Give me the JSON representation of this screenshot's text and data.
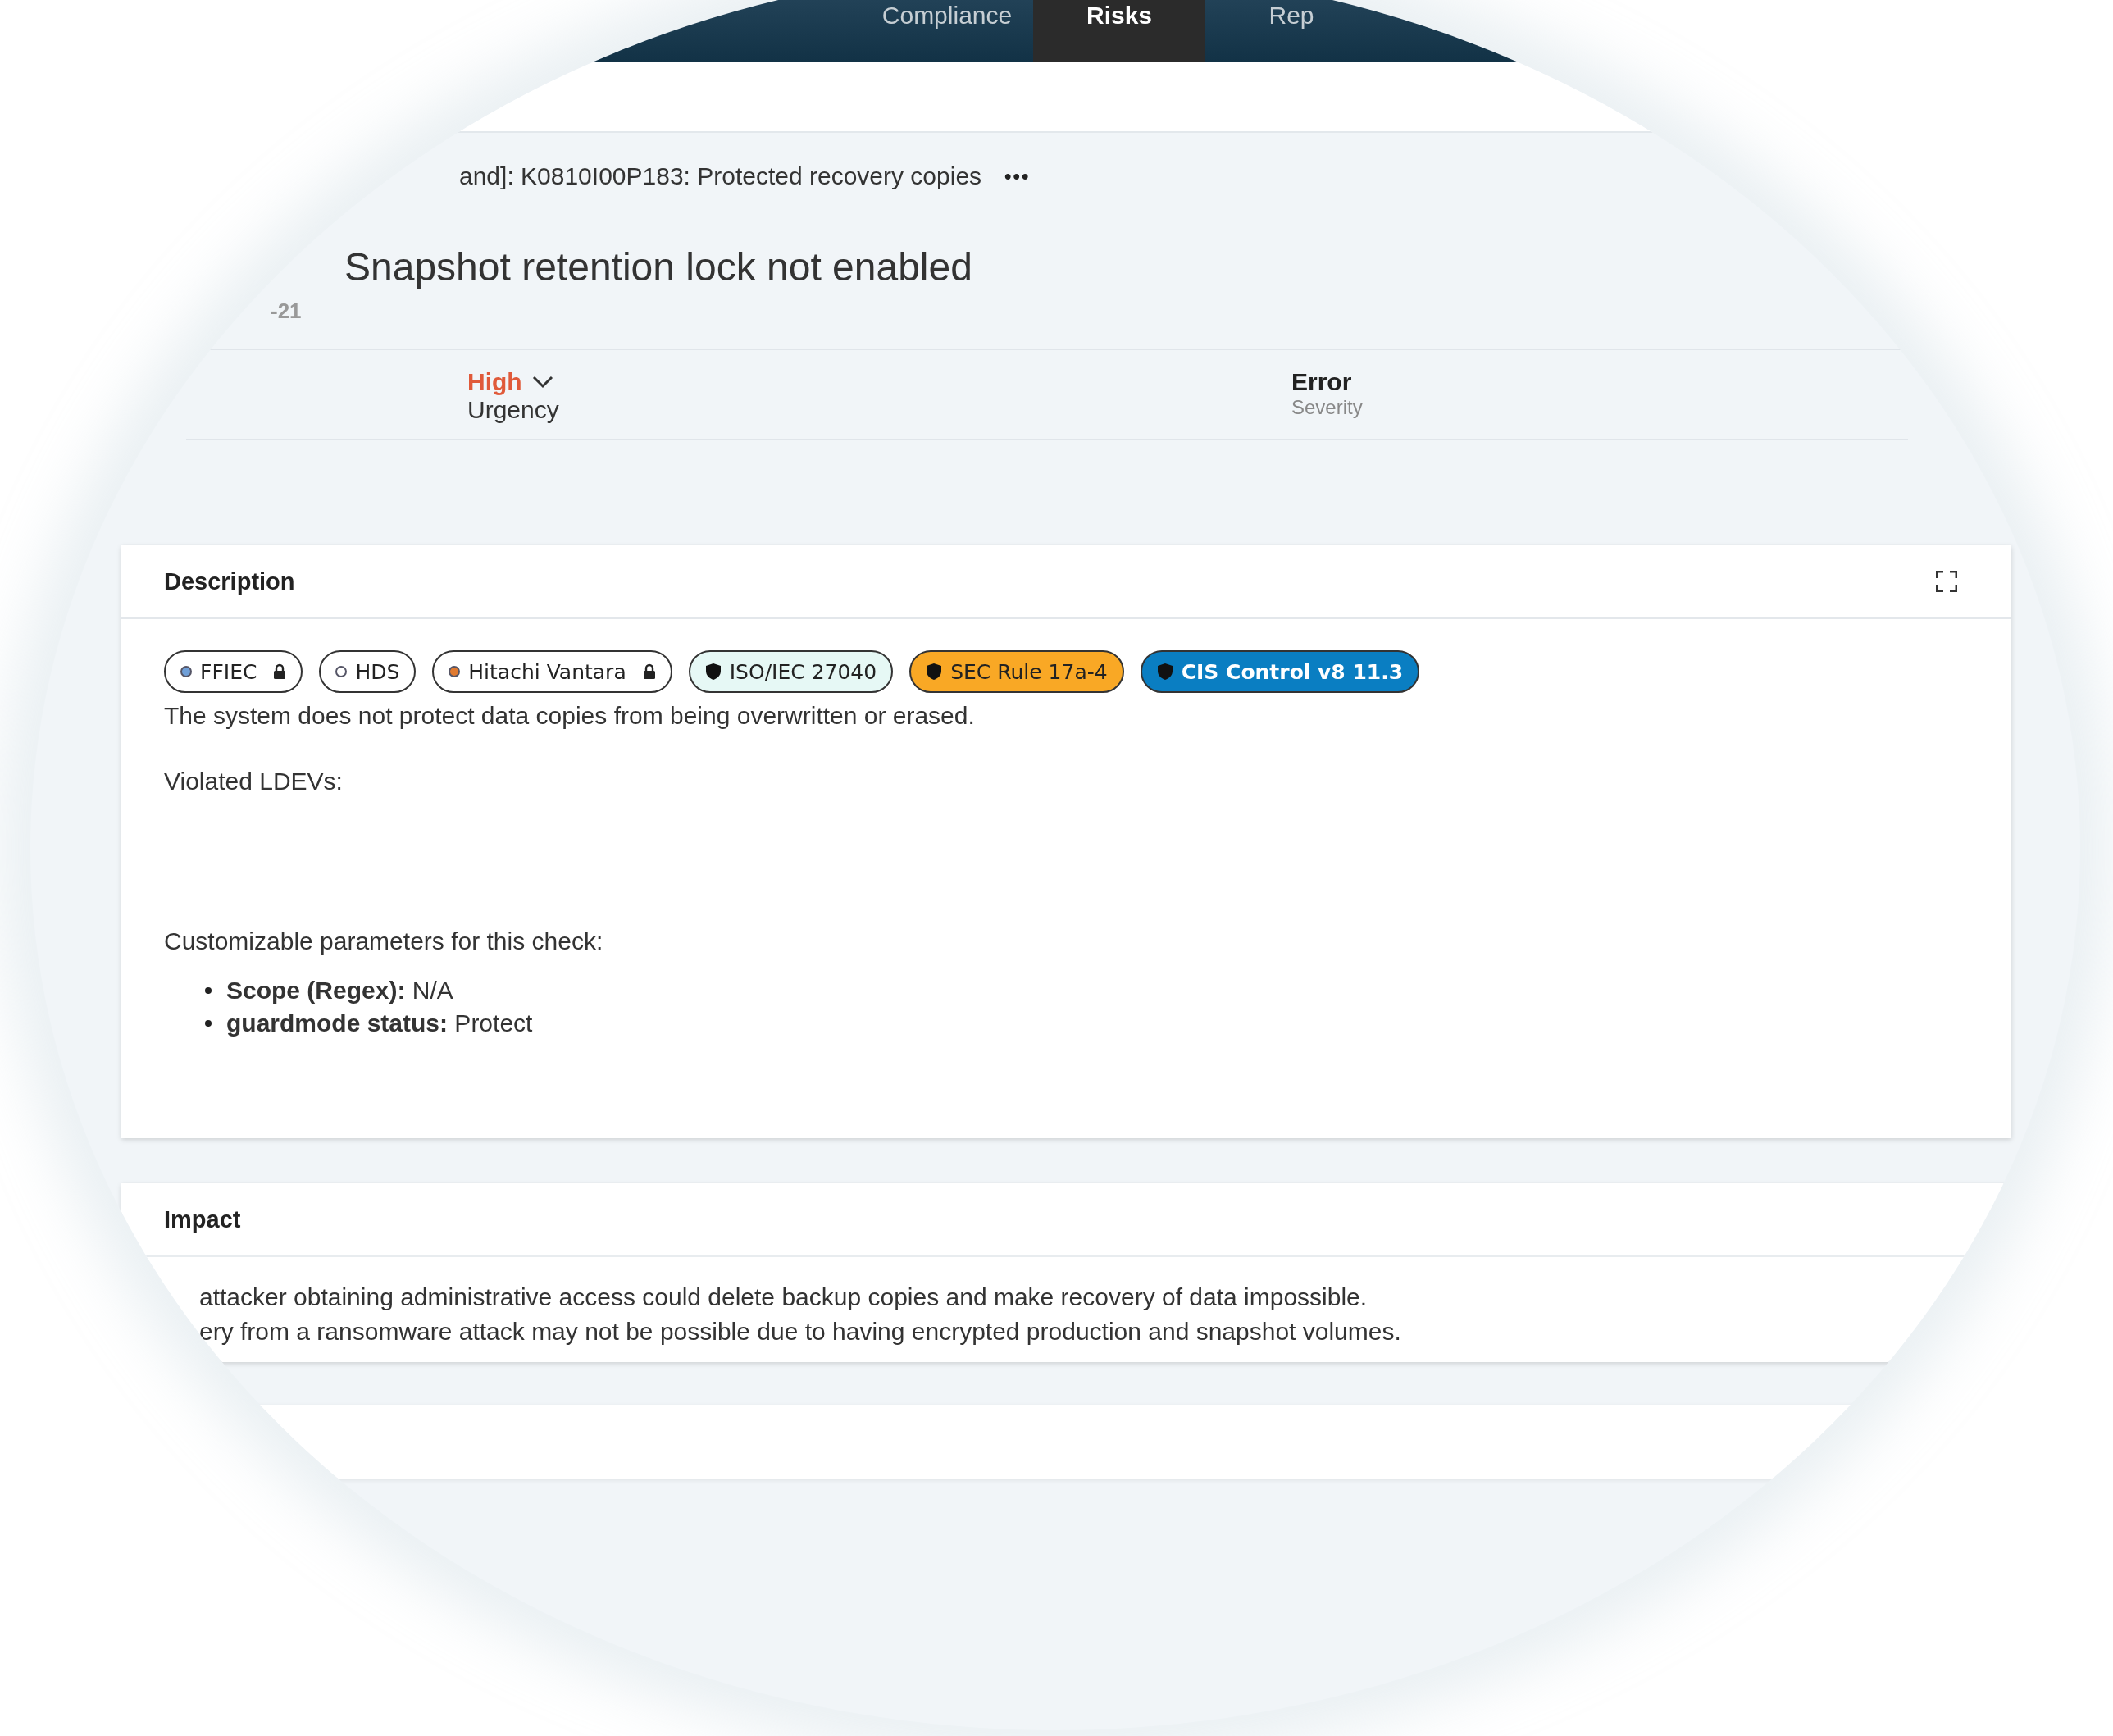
{
  "nav": {
    "tabs": [
      {
        "label": "Compliance",
        "selected": false
      },
      {
        "label": "Risks",
        "selected": true
      },
      {
        "label": "Rep",
        "selected": false
      }
    ]
  },
  "breadcrumb": {
    "text": "and]: K0810I00P183: Protected recovery copies",
    "more": "•••"
  },
  "title": "Snapshot retention lock not enabled",
  "subtitle": "-21",
  "fields": [
    {
      "kind": "dropdown",
      "value": "High",
      "label": "Urgency",
      "color": "#e05a3a"
    },
    {
      "kind": "plain",
      "value": "Error",
      "label": "Severity",
      "color": "#222222"
    }
  ],
  "description": {
    "title": "Description",
    "tags": [
      {
        "kind": "dot",
        "label": "FFIEC",
        "color": "#6f9fd8",
        "locked": true
      },
      {
        "kind": "dot",
        "label": "HDS",
        "color": "#ffffff",
        "locked": false
      },
      {
        "kind": "dot",
        "label": "Hitachi Vantara",
        "color": "#e07a30",
        "locked": true
      },
      {
        "kind": "shield",
        "label": "ISO/IEC 27040",
        "color": "#e6f8f5"
      },
      {
        "kind": "shield",
        "label": "SEC Rule 17a-4",
        "color": "#f9a825"
      },
      {
        "kind": "shield",
        "label": "CIS Control v8 11.3",
        "color": "#0a7ec2"
      }
    ],
    "text": "The system does not protect data copies from being overwritten or erased.",
    "violated": "Violated LDEVs:",
    "params_intro": "Customizable parameters for this check:",
    "params": [
      "**Scope (Regex):** N/A",
      "**guardmode status:** Protect"
    ]
  },
  "impact": {
    "title": "Impact",
    "lines": [
      "attacker obtaining administrative access could delete backup copies and make recovery of data impossible.",
      "ery from a ransomware attack may not be possible due to having encrypted production and snapshot volumes."
    ]
  }
}
